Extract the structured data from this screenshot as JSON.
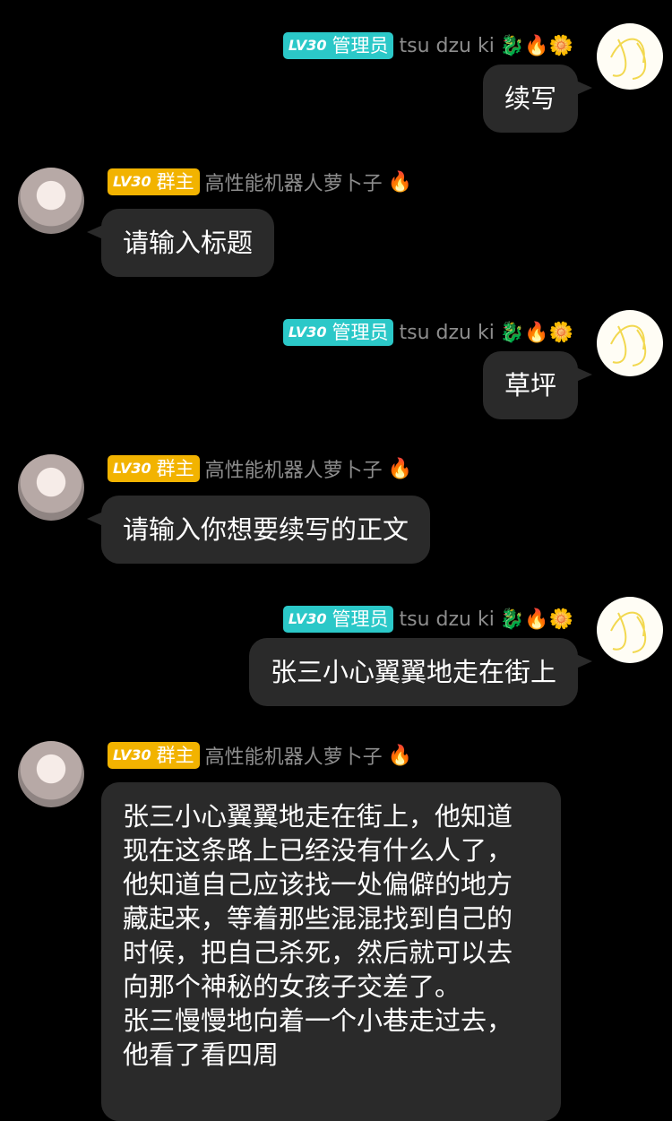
{
  "messages": [
    {
      "side": "right",
      "badge": "管理员",
      "level": "LV30",
      "name": "tsu dzu ki",
      "emojis": "🐉🔥🌼",
      "text": "续写"
    },
    {
      "side": "left",
      "badge": "群主",
      "level": "LV30",
      "name": "高性能机器人萝卜子",
      "emojis": "🔥",
      "text": "请输入标题"
    },
    {
      "side": "right",
      "badge": "管理员",
      "level": "LV30",
      "name": "tsu dzu ki",
      "emojis": "🐉🔥🌼",
      "text": "草坪"
    },
    {
      "side": "left",
      "badge": "群主",
      "level": "LV30",
      "name": "高性能机器人萝卜子",
      "emojis": "🔥",
      "text": "请输入你想要续写的正文"
    },
    {
      "side": "right",
      "badge": "管理员",
      "level": "LV30",
      "name": "tsu dzu ki",
      "emojis": "🐉🔥🌼",
      "text": "张三小心翼翼地走在街上"
    },
    {
      "side": "left",
      "badge": "群主",
      "level": "LV30",
      "name": "高性能机器人萝卜子",
      "emojis": "🔥",
      "lines": [
        "张三小心翼翼地走在街上，他知道",
        "现在这条路上已经没有什么人了，",
        "他知道自己应该找一处偏僻的地方",
        "藏起来，等着那些混混找到自己的",
        "时候，把自己杀死，然后就可以去",
        "向那个神秘的女孩子交差了。",
        "张三慢慢地向着一个小巷走过去，",
        "他看了看四周"
      ]
    }
  ]
}
